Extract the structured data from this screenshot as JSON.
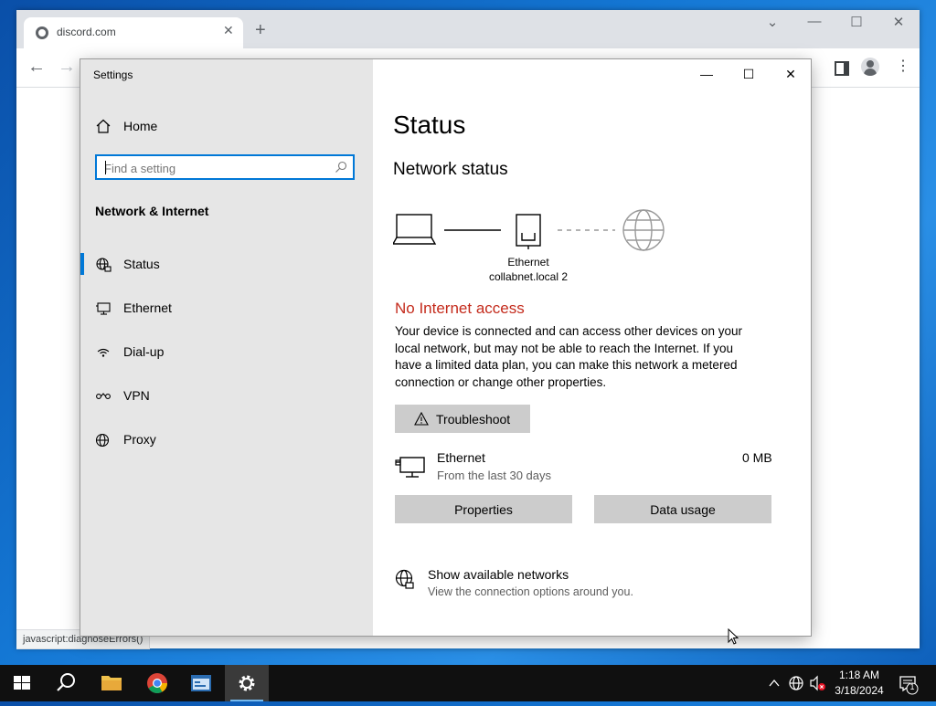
{
  "browser": {
    "tab_title": "discord.com",
    "tab_close": "✕",
    "new_tab": "+",
    "status_text": "javascript:diagnoseErrors()"
  },
  "settings": {
    "window_title": "Settings",
    "home_label": "Home",
    "search_placeholder": "Find a setting",
    "section_title": "Network & Internet",
    "nav": [
      {
        "label": "Status",
        "icon": "globe-network-icon"
      },
      {
        "label": "Ethernet",
        "icon": "ethernet-monitor-icon"
      },
      {
        "label": "Dial-up",
        "icon": "dialup-icon"
      },
      {
        "label": "VPN",
        "icon": "vpn-icon"
      },
      {
        "label": "Proxy",
        "icon": "globe-icon"
      }
    ],
    "page_title": "Status",
    "network_status_heading": "Network status",
    "ethernet_caption_line1": "Ethernet",
    "ethernet_caption_line2": "collabnet.local 2",
    "no_internet": "No Internet access",
    "description": "Your device is connected and can access other devices on your local network, but may not be able to reach the Internet. If you have a limited data plan, you can make this network a metered connection or change other properties.",
    "troubleshoot_label": "Troubleshoot",
    "ethernet_row": {
      "name": "Ethernet",
      "sub": "From the last 30 days",
      "usage": "0 MB"
    },
    "properties_label": "Properties",
    "data_usage_label": "Data usage",
    "show_networks_title": "Show available networks",
    "show_networks_sub": "View the connection options around you."
  },
  "taskbar": {
    "time": "1:18 AM",
    "date": "3/18/2024",
    "notification_count": "1"
  },
  "colors": {
    "accent": "#0078d7",
    "error": "#c42b1c",
    "sidebar_bg": "#e6e6e6"
  }
}
